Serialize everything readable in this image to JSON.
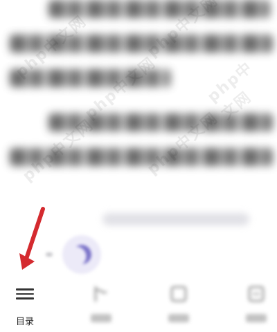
{
  "reader": {
    "paragraph_lines": 7
  },
  "watermark": {
    "text": "php中文网"
  },
  "arrow": {
    "color": "#d42a2f"
  },
  "night_mode": {
    "icon": "moon-icon",
    "accent": "#7b73c9"
  },
  "bottom_toolbar": {
    "tabs": [
      {
        "label": "目录",
        "icon": "menu-icon"
      },
      {
        "label": "",
        "icon": "progress-icon"
      },
      {
        "label": "",
        "icon": "font-icon"
      },
      {
        "label": "",
        "icon": "settings-icon"
      }
    ]
  }
}
